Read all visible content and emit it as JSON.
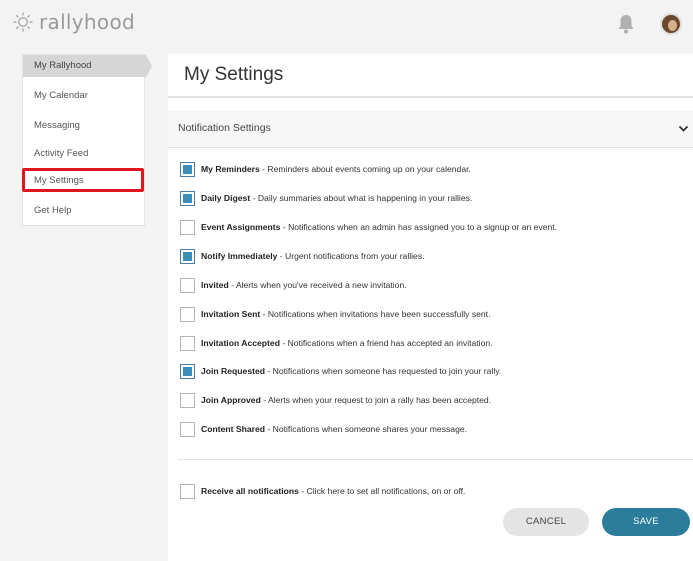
{
  "app": {
    "brand": "rallyhood",
    "logo_icon": "sun-gear-logo",
    "bell_icon": "bell-icon",
    "colors": {
      "accent": "#2c7d9b",
      "checkbox": "#3b8fb8",
      "highlight": "#e0141e",
      "brand_gray": "#9a9a9a"
    }
  },
  "sidebar": {
    "items": [
      {
        "label": "My Rallyhood",
        "active": true
      },
      {
        "label": "My Calendar",
        "active": false
      },
      {
        "label": "Messaging",
        "active": false
      },
      {
        "label": "Activity Feed",
        "active": false
      },
      {
        "label": "My Settings",
        "active": false,
        "highlighted": true
      },
      {
        "label": "Get Help",
        "active": false
      }
    ]
  },
  "main": {
    "title": "My Settings",
    "section": {
      "title": "Notification Settings",
      "toggle_icon": "chevron-down-icon"
    },
    "notifications": [
      {
        "name": "My Reminders",
        "desc": " - Reminders about events coming up on your calendar.",
        "checked": true
      },
      {
        "name": "Daily Digest",
        "desc": " - Daily summaries about what is happening in your rallies.",
        "checked": true
      },
      {
        "name": "Event Assignments",
        "desc": " - Notifications when an admin has assigned you to a signup or an event.",
        "checked": false
      },
      {
        "name": "Notify Immediately",
        "desc": " - Urgent notifications from your rallies.",
        "checked": true
      },
      {
        "name": "Invited",
        "desc": " - Alerts when you've received a new invitation.",
        "checked": false
      },
      {
        "name": "Invitation Sent",
        "desc": " - Notifications when invitations have been successfully sent.",
        "checked": false
      },
      {
        "name": "Invitation Accepted",
        "desc": " - Notifications when a friend has accepted an invitation.",
        "checked": false
      },
      {
        "name": "Join Requested",
        "desc": " - Notifications when someone has requested to join your rally.",
        "checked": true
      },
      {
        "name": "Join Approved",
        "desc": " - Alerts when your request to join a rally has been accepted.",
        "checked": false
      },
      {
        "name": "Content Shared",
        "desc": " - Notifications when someone shares your message.",
        "checked": false
      }
    ],
    "receive_all": {
      "name": "Receive all notifications",
      "desc": " - Click here to set all notifications, on or off.",
      "checked": false
    },
    "buttons": {
      "cancel": "CANCEL",
      "save": "SAVE"
    }
  }
}
